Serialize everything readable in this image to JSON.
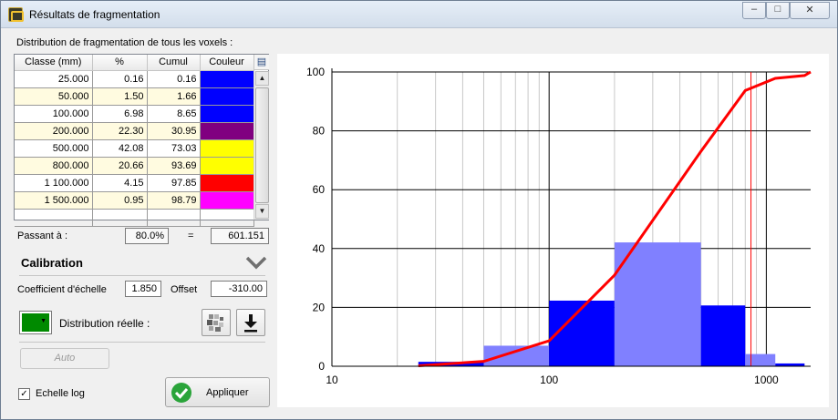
{
  "window": {
    "title": "Résultats de fragmentation",
    "minimize": "–",
    "maximize": "□",
    "close": "✕"
  },
  "distribution_label": "Distribution de fragmentation de tous les voxels :",
  "table": {
    "columns": [
      "Classe (mm)",
      "%",
      "Cumul",
      "Couleur"
    ],
    "rows": [
      {
        "classe": "25.000",
        "pct": "0.16",
        "cumul": "0.16",
        "color": "#0000ff"
      },
      {
        "classe": "50.000",
        "pct": "1.50",
        "cumul": "1.66",
        "color": "#0000ff"
      },
      {
        "classe": "100.000",
        "pct": "6.98",
        "cumul": "8.65",
        "color": "#0000ff"
      },
      {
        "classe": "200.000",
        "pct": "22.30",
        "cumul": "30.95",
        "color": "#800080"
      },
      {
        "classe": "500.000",
        "pct": "42.08",
        "cumul": "73.03",
        "color": "#ffff00"
      },
      {
        "classe": "800.000",
        "pct": "20.66",
        "cumul": "93.69",
        "color": "#ffff00"
      },
      {
        "classe": "1 100.000",
        "pct": "4.15",
        "cumul": "97.85",
        "color": "#ff0000"
      },
      {
        "classe": "1 500.000",
        "pct": "0.95",
        "cumul": "98.79",
        "color": "#ff00ff"
      }
    ]
  },
  "passant": {
    "label": "Passant à :",
    "percent": "80.0%",
    "equals": "=",
    "value": "601.151"
  },
  "calibration": {
    "title": "Calibration",
    "coef_label": "Coefficient d'échelle",
    "coef_value": "1.850",
    "offset_label": "Offset",
    "offset_value": "-310.00",
    "dist_label": "Distribution réelle :",
    "dist_color": "#008a00",
    "auto_label": "Auto"
  },
  "log_checkbox": {
    "label": "Echelle log",
    "checked": true
  },
  "apply_button": "Appliquer",
  "chart_data": {
    "type": "bar",
    "x_scale": "log",
    "xlim": [
      10,
      1600
    ],
    "ylim": [
      0,
      100
    ],
    "xticks": [
      "10",
      "100",
      "1000"
    ],
    "yticks": [
      "0",
      "20",
      "40",
      "60",
      "80",
      "100"
    ],
    "bars": [
      {
        "x0": 25,
        "x1": 50,
        "value": 1.5,
        "color": "#0000ff"
      },
      {
        "x0": 50,
        "x1": 100,
        "value": 6.98,
        "color": "#8080ff"
      },
      {
        "x0": 100,
        "x1": 200,
        "value": 22.3,
        "color": "#0000ff"
      },
      {
        "x0": 200,
        "x1": 500,
        "value": 42.08,
        "color": "#8080ff"
      },
      {
        "x0": 500,
        "x1": 800,
        "value": 20.66,
        "color": "#0000ff"
      },
      {
        "x0": 800,
        "x1": 1100,
        "value": 4.15,
        "color": "#8080ff"
      },
      {
        "x0": 1100,
        "x1": 1500,
        "value": 0.95,
        "color": "#0000ff"
      }
    ],
    "cumulative": {
      "x": [
        25,
        50,
        100,
        200,
        500,
        800,
        1100,
        1500,
        1600
      ],
      "y": [
        0.16,
        1.66,
        8.65,
        30.95,
        73.03,
        93.69,
        97.85,
        98.79,
        100
      ],
      "color": "#ff0000"
    },
    "marker_x": 850,
    "marker_color": "#ff0000"
  }
}
